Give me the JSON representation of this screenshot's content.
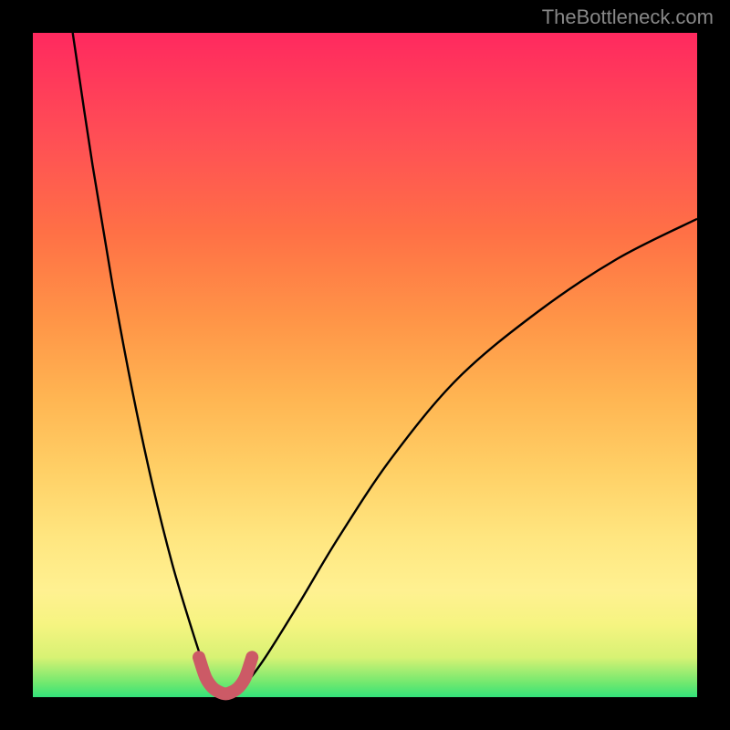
{
  "watermark": "TheBottleneck.com",
  "chart_data": {
    "type": "line",
    "title": "",
    "xlabel": "",
    "ylabel": "",
    "xlim": [
      0,
      100
    ],
    "ylim": [
      0,
      100
    ],
    "grid": false,
    "legend": false,
    "series": [
      {
        "name": "left-branch",
        "x": [
          6,
          9,
          12,
          15,
          18,
          21,
          24,
          26,
          27,
          28
        ],
        "y": [
          100,
          80,
          62,
          46,
          32,
          20,
          10,
          4,
          2,
          0.5
        ]
      },
      {
        "name": "right-branch",
        "x": [
          30,
          32,
          35,
          40,
          46,
          54,
          64,
          76,
          88,
          100
        ],
        "y": [
          0.5,
          2,
          6,
          14,
          24,
          36,
          48,
          58,
          66,
          72
        ]
      },
      {
        "name": "minimum-marker",
        "x": [
          25,
          26,
          27,
          28,
          29,
          30,
          31,
          32,
          33
        ],
        "y": [
          6,
          3,
          1.5,
          0.8,
          0.5,
          0.8,
          1.5,
          3,
          6
        ]
      }
    ],
    "gradient_stops": [
      {
        "pos": 0,
        "color": "#33e27a"
      },
      {
        "pos": 2,
        "color": "#6de86f"
      },
      {
        "pos": 6,
        "color": "#d8f274"
      },
      {
        "pos": 11,
        "color": "#f6f481"
      },
      {
        "pos": 16,
        "color": "#fff191"
      },
      {
        "pos": 24,
        "color": "#ffe680"
      },
      {
        "pos": 34,
        "color": "#ffd066"
      },
      {
        "pos": 45,
        "color": "#ffb552"
      },
      {
        "pos": 57,
        "color": "#ff9447"
      },
      {
        "pos": 70,
        "color": "#ff7046"
      },
      {
        "pos": 84,
        "color": "#ff4f55"
      },
      {
        "pos": 100,
        "color": "#ff295f"
      }
    ],
    "colors": {
      "curve": "#000000",
      "marker": "#cc5a66",
      "background_frame": "#000000"
    }
  }
}
